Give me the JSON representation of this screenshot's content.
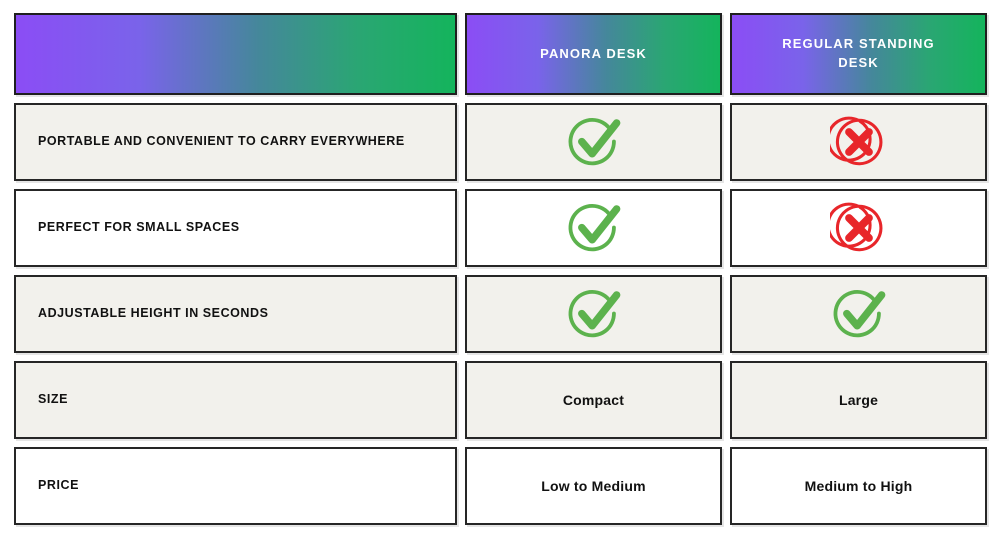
{
  "theme": {
    "gradient_start": "#8b4df5",
    "gradient_end": "#14b45c",
    "check_color": "#5cb24d",
    "cross_color": "#e8262a",
    "cell_border": "#262626",
    "row_shade": "#f2f1ec",
    "row_plain": "#ffffff",
    "text_color": "#111111",
    "header_text_color": "#ffffff"
  },
  "header": {
    "feature_column_label": "",
    "columns": [
      {
        "label": "PANORA DESK"
      },
      {
        "label": "REGULAR STANDING DESK"
      }
    ]
  },
  "rows": [
    {
      "feature": "PORTABLE AND CONVENIENT TO CARRY EVERYWHERE",
      "panora": {
        "type": "icon",
        "icon": "check-circle-icon",
        "value": ""
      },
      "regular": {
        "type": "icon",
        "icon": "cross-circle-icon",
        "value": ""
      }
    },
    {
      "feature": "PERFECT FOR SMALL SPACES",
      "panora": {
        "type": "icon",
        "icon": "check-circle-icon",
        "value": ""
      },
      "regular": {
        "type": "icon",
        "icon": "cross-circle-icon",
        "value": ""
      }
    },
    {
      "feature": "ADJUSTABLE HEIGHT IN SECONDS",
      "panora": {
        "type": "icon",
        "icon": "check-circle-icon",
        "value": ""
      },
      "regular": {
        "type": "icon",
        "icon": "check-circle-icon",
        "value": ""
      }
    },
    {
      "feature": "SIZE",
      "panora": {
        "type": "text",
        "icon": "",
        "value": "Compact"
      },
      "regular": {
        "type": "text",
        "icon": "",
        "value": "Large"
      }
    },
    {
      "feature": "PRICE",
      "panora": {
        "type": "text",
        "icon": "",
        "value": "Low to Medium"
      },
      "regular": {
        "type": "text",
        "icon": "",
        "value": "Medium to High"
      }
    }
  ]
}
